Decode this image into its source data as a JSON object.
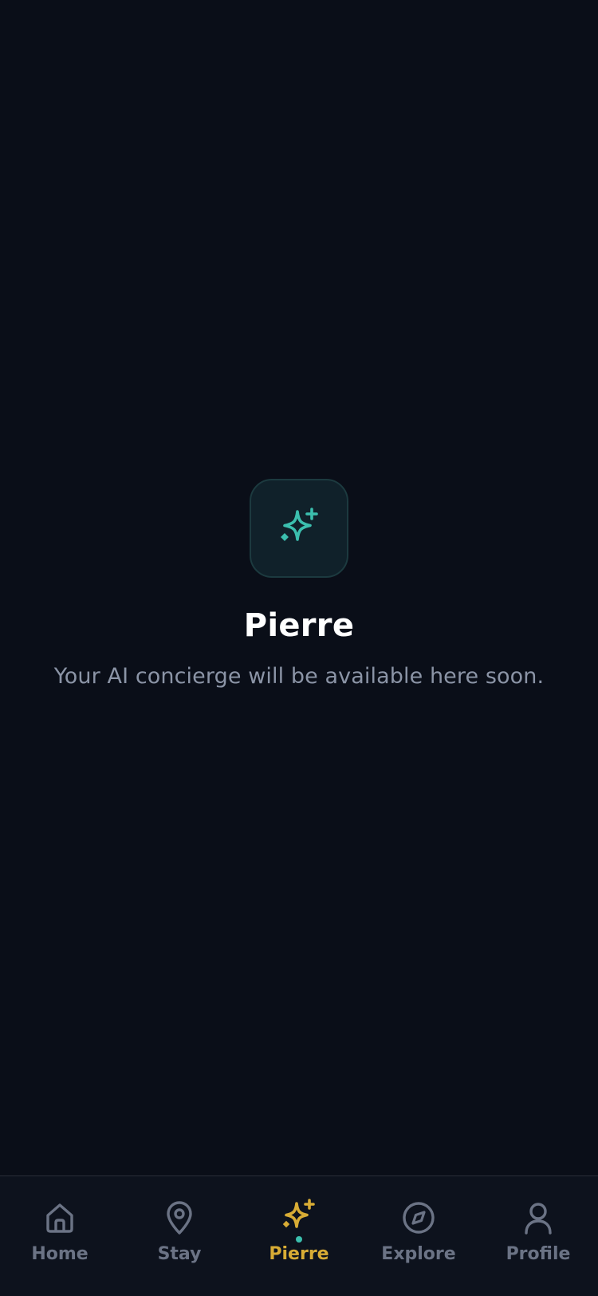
{
  "colors": {
    "background": "#0a0e18",
    "tabbar_background": "#0d121d",
    "accent_teal": "#3bbfae",
    "accent_gold": "#d8ac35",
    "inactive_tab": "#6b7385",
    "subtitle": "#8b94a6",
    "title": "#ffffff"
  },
  "hero": {
    "icon": "sparkles-icon",
    "title": "Pierre",
    "subtitle": "Your AI concierge will be available here soon."
  },
  "tabbar": {
    "active_tab": "Pierre",
    "tabs": [
      {
        "label": "Home",
        "icon": "home-icon"
      },
      {
        "label": "Stay",
        "icon": "map-pin-icon"
      },
      {
        "label": "Pierre",
        "icon": "sparkles-icon"
      },
      {
        "label": "Explore",
        "icon": "compass-icon"
      },
      {
        "label": "Profile",
        "icon": "user-icon"
      }
    ]
  }
}
